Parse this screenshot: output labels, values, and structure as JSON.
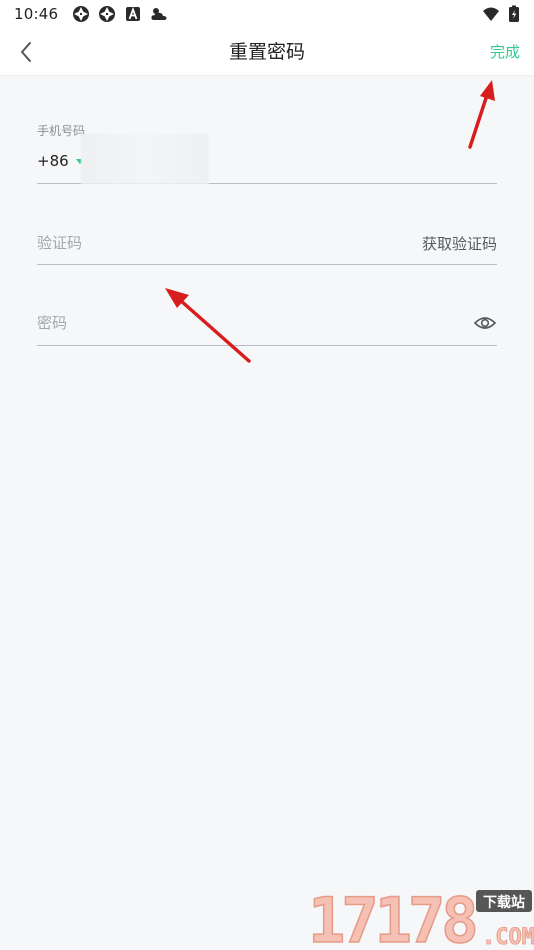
{
  "status_bar": {
    "time": "10:46",
    "icons": [
      "aperture-icon",
      "aperture-icon",
      "a-badge-icon",
      "weather-icon"
    ],
    "right_icons": [
      "wifi-icon",
      "battery-icon"
    ]
  },
  "nav": {
    "back_icon": "chevron-left-icon",
    "title": "重置密码",
    "done_label": "完成"
  },
  "form": {
    "phone_label": "手机号码",
    "country_code": "+86",
    "phone_value": "",
    "code_placeholder": "验证码",
    "get_code_label": "获取验证码",
    "password_placeholder": "密码",
    "eye_icon": "eye-icon"
  },
  "colors": {
    "accent": "#34c98e",
    "background": "#f6f7f9",
    "annotation_arrow": "#d81d1d"
  },
  "watermark": {
    "digits": "17178",
    "badge": "下载站",
    "suffix": ".COM"
  }
}
